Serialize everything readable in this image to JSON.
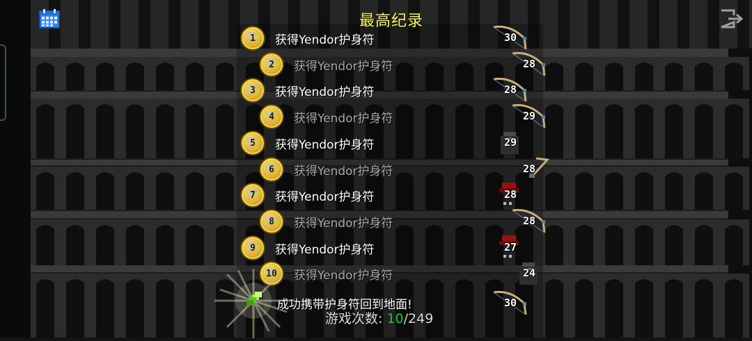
{
  "title": "最高纪录",
  "top_bar": {
    "left_icon": "calendar-icon",
    "right_icon": "exit-icon"
  },
  "records": [
    {
      "rank": "1",
      "text": "获得Yendor护身符",
      "level": "30",
      "hero": "huntress-bow"
    },
    {
      "rank": "2",
      "text": "获得Yendor护身符",
      "level": "28",
      "hero": "huntress-bow"
    },
    {
      "rank": "3",
      "text": "获得Yendor护身符",
      "level": "28",
      "hero": "huntress-bow"
    },
    {
      "rank": "4",
      "text": "获得Yendor护身符",
      "level": "29",
      "hero": "huntress-bow"
    },
    {
      "rank": "5",
      "text": "获得Yendor护身符",
      "level": "29",
      "hero": "warrior-helmet"
    },
    {
      "rank": "6",
      "text": "获得Yendor护身符",
      "level": "28",
      "hero": "rogue-dagger"
    },
    {
      "rank": "7",
      "text": "获得Yendor护身符",
      "level": "28",
      "hero": "mage-hat"
    },
    {
      "rank": "8",
      "text": "获得Yendor护身符",
      "level": "28",
      "hero": "huntress-bow"
    },
    {
      "rank": "9",
      "text": "获得Yendor护身符",
      "level": "27",
      "hero": "mage-hat"
    },
    {
      "rank": "10",
      "text": "获得Yendor护身符",
      "level": "24",
      "hero": "warrior-helmet"
    }
  ],
  "latest": {
    "text": "成功携带护身符回到地面!",
    "level": "30",
    "hero": "huntress-bow",
    "icon": "green-gem-icon"
  },
  "footer": {
    "label": "游戏次数:",
    "current": "10",
    "total": "/249"
  },
  "colors": {
    "title": "#ffff44",
    "count_current": "#22cc22",
    "badge_gold": "#e3b228"
  }
}
